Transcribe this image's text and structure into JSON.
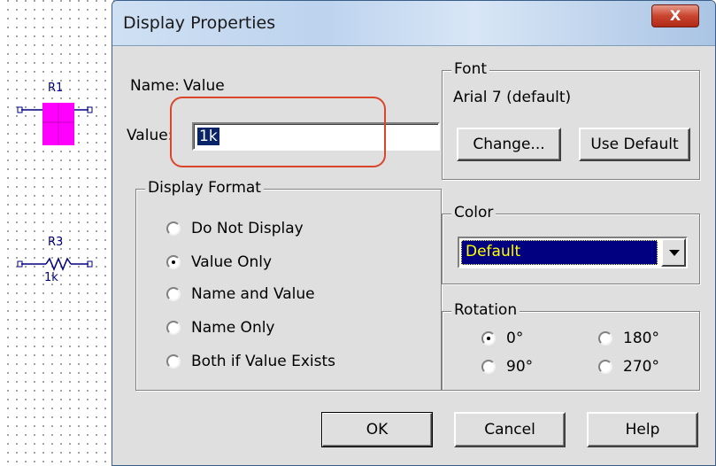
{
  "schematic": {
    "components": [
      {
        "ref": "R1",
        "value": ""
      },
      {
        "ref": "R3",
        "value": "1k"
      }
    ]
  },
  "dialog": {
    "title": "Display Properties",
    "close_label": "X",
    "name_label": "Name:",
    "name_value": "Value",
    "value_label": "Value:",
    "value_input": "1k",
    "display_format": {
      "title": "Display Format",
      "options": [
        {
          "label": "Do Not Display",
          "checked": false
        },
        {
          "label": "Value Only",
          "checked": true
        },
        {
          "label": "Name and Value",
          "checked": false
        },
        {
          "label": "Name Only",
          "checked": false
        },
        {
          "label": "Both if Value Exists",
          "checked": false
        }
      ]
    },
    "font": {
      "title": "Font",
      "current": "Arial 7 (default)",
      "change_label": "Change...",
      "use_default_label": "Use Default"
    },
    "color": {
      "title": "Color",
      "selected": "Default",
      "selected_bg": "#000080",
      "selected_fg": "#ffff00"
    },
    "rotation": {
      "title": "Rotation",
      "options": [
        {
          "label": "0°",
          "checked": true
        },
        {
          "label": "180°",
          "checked": false
        },
        {
          "label": "90°",
          "checked": false
        },
        {
          "label": "270°",
          "checked": false
        }
      ]
    },
    "buttons": {
      "ok": "OK",
      "cancel": "Cancel",
      "help": "Help"
    }
  },
  "colors": {
    "highlight_annotation": "#d9462c",
    "component_magenta": "#ff00ff",
    "component_blue": "#000080"
  }
}
